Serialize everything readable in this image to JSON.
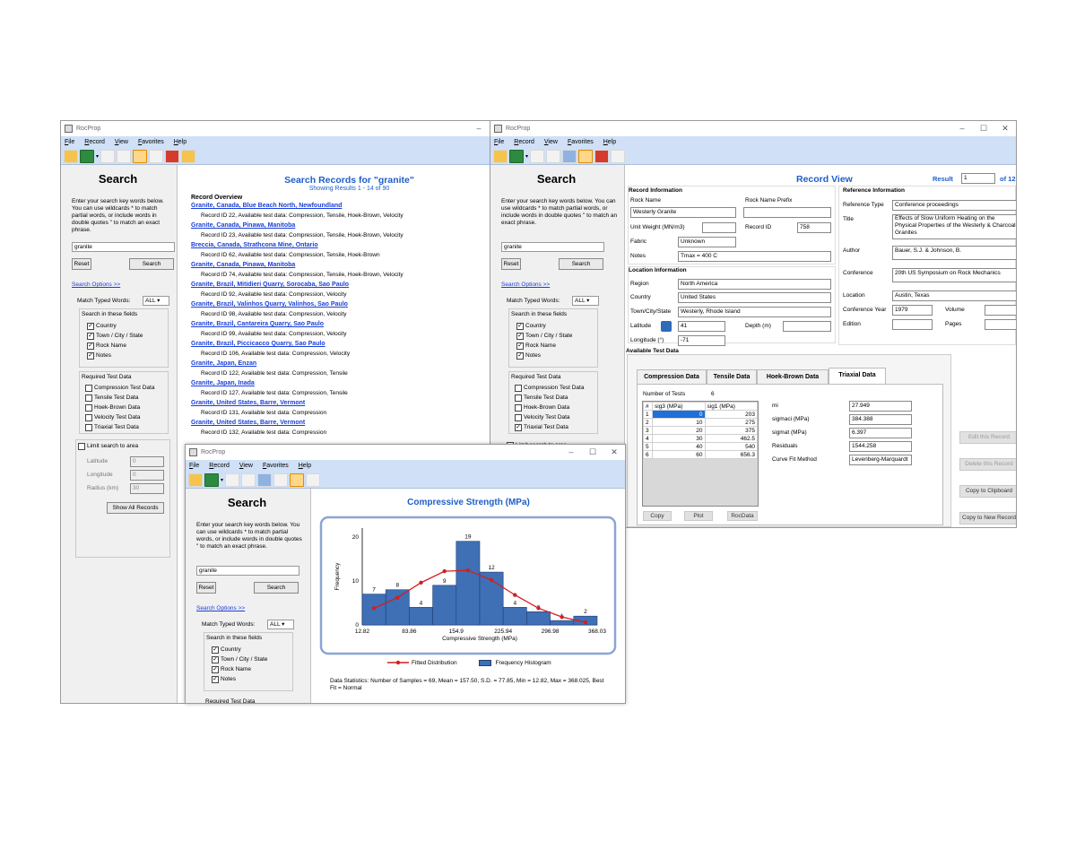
{
  "app_name": "RocProp",
  "menu": [
    "File",
    "Record",
    "View",
    "Favorites",
    "Help"
  ],
  "search_pane": {
    "title": "Search",
    "description": "Enter your search key words below. You can use wildcards * to match partial words, or include words in double quotes \" to match an exact phrase.",
    "query": "granite",
    "reset_label": "Reset",
    "search_label": "Search",
    "options_link": "Search Options  >>",
    "match_label": "Match Typed Words:",
    "match_value": "ALL",
    "fields_label": "Search in these fields",
    "fields": [
      "Country",
      "Town / City / State",
      "Rock Name",
      "Notes"
    ],
    "required_label": "Required Test Data",
    "required": [
      "Compression Test Data",
      "Tensile Test Data",
      "Hoek-Brown Data",
      "Velocity Test Data",
      "Triaxial Test Data"
    ],
    "limit_label": "Limit search to area",
    "latitude_label": "Latitude",
    "longitude_label": "Longitude",
    "radius_label": "Radius (km)",
    "latitude_value": "0",
    "longitude_value": "0",
    "radius_value": "30",
    "show_all_label": "Show All Records"
  },
  "results": {
    "title": "Search Records for \"granite\"",
    "subtitle": "Showing Results 1 - 14  of  90",
    "overview_label": "Record Overview",
    "records": [
      {
        "name": "Granite,  Canada,  Blue Beach North, Newfoundland",
        "info": "Record ID 22,  Available test data: Compression, Tensile, Hoek-Brown, Velocity"
      },
      {
        "name": "Granite,  Canada,  Pinawa, Manitoba",
        "info": "Record ID 23,  Available test data: Compression, Tensile, Hoek-Brown, Velocity"
      },
      {
        "name": "Breccia,  Canada,  Strathcona Mine, Ontario",
        "info": "Record ID 62,  Available test data: Compression, Tensile, Hoek-Brown"
      },
      {
        "name": "Granite,  Canada,  Pinawa, Manitoba",
        "info": "Record ID 74,  Available test data: Compression, Tensile, Hoek-Brown, Velocity"
      },
      {
        "name": "Granite,  Brazil,  Mitidieri Quarry, Sorocaba, Sao Paulo",
        "info": "Record ID 92,  Available test data: Compression, Velocity"
      },
      {
        "name": "Granite,  Brazil,  Valinhos Quarry, Valinhos, Sao Paulo",
        "info": "Record ID 98,  Available test data: Compression, Velocity"
      },
      {
        "name": "Granite,  Brazil,  Cantareira Quarry, Sao Paulo",
        "info": "Record ID 99,  Available test data: Compression, Velocity"
      },
      {
        "name": "Granite,  Brazil,  Piccicacco Quarry, Sao Paulo",
        "info": "Record ID 106,  Available test data: Compression, Velocity"
      },
      {
        "name": "Granite,  Japan,  Enzan",
        "info": "Record ID 122,  Available test data: Compression, Tensile"
      },
      {
        "name": "Granite,  Japan,  Inada",
        "info": "Record ID 127,  Available test data: Compression, Tensile"
      },
      {
        "name": "Granite,  United States,  Barre, Vermont",
        "info": "Record ID 131,  Available test data: Compression"
      },
      {
        "name": "Granite,  United States,  Barre, Vermont",
        "info": "Record ID 132,  Available test data: Compression"
      }
    ]
  },
  "record_view": {
    "title": "Record View",
    "result_label": "Result",
    "result_value": "1",
    "result_of": "of 12",
    "record_info_label": "Record Information",
    "rock_name_label": "Rock Name",
    "rock_name": "Westerly Granite",
    "prefix_label": "Rock Name Prefix",
    "unit_weight_label": "Unit Weight (MN/m3)",
    "record_id_label": "Record ID",
    "record_id": "758",
    "fabric_label": "Fabric",
    "fabric": "Unknown",
    "notes_label": "Notes",
    "notes": "Tmax = 400 C",
    "location_label": "Location Information",
    "region_label": "Region",
    "region": "North America",
    "country_label": "Country",
    "country": "United States",
    "town_label": "Town/City/State",
    "town": "Westerly, Rhode Island",
    "latitude_label": "Latitude",
    "latitude": "41",
    "depth_label": "Depth (m)",
    "longitude_label": "Longitude (°)",
    "longitude": "-71",
    "ref_info_label": "Reference Information",
    "ref_type_label": "Reference Type",
    "ref_type": "Conference proceedings",
    "ref_title_label": "Title",
    "ref_title": "Effects of Slow Uniform Heating on the Physical Properties of the Westerly & Charcoal Granites",
    "author_label": "Author",
    "author": "Bauer, S.J. & Johnson, B.",
    "conference_label": "Conference",
    "conference": "20th US Symposium on Rock Mechanics",
    "location_ref_label": "Location",
    "location_ref": "Austin, Texas",
    "conf_year_label": "Conference Year",
    "conf_year": "1979",
    "volume_label": "Volume",
    "edition_label": "Edition",
    "pages_label": "Pages",
    "available_label": "Available Test Data",
    "tabs": [
      "Compression Data",
      "Tensile Data",
      "Hoek-Brown Data",
      "Triaxial Data"
    ],
    "num_tests_label": "Number of Tests",
    "num_tests": "6",
    "table_headers": [
      "#",
      "sig3 (MPa)",
      "sig1 (MPa)"
    ],
    "table_rows": [
      [
        "1",
        "0",
        "203"
      ],
      [
        "2",
        "10",
        "275"
      ],
      [
        "3",
        "20",
        "375"
      ],
      [
        "4",
        "30",
        "462.5"
      ],
      [
        "5",
        "40",
        "540"
      ],
      [
        "6",
        "60",
        "656.3"
      ]
    ],
    "params": [
      {
        "label": "mi",
        "value": "27.949"
      },
      {
        "label": "sigmaci (MPa)",
        "value": "384.388"
      },
      {
        "label": "sigmat  (MPa)",
        "value": "6.397"
      },
      {
        "label": "Residuals",
        "value": "1544.258"
      },
      {
        "label": "Curve Fit Method",
        "value": "Levenberg-Marquardt"
      }
    ],
    "copy_label": "Copy",
    "plot_label": "Plot",
    "rocdata_label": "RocData",
    "edit_label": "Edit this Record",
    "delete_label": "Delete this Record",
    "clipboard_label": "Copy to Clipboard",
    "new_record_label": "Copy to New Record"
  },
  "chart_window": {
    "chart_title": "Compressive Strength (MPa)",
    "stats": "Data Statistics:   Number of Samples = 69,   Mean = 157.50,   S.D. = 77.85,   Min = 12.82,   Max = 368.025,   Best Fit = Normal"
  },
  "chart_data": {
    "type": "bar",
    "title": "Compressive Strength (MPa)",
    "xlabel": "Compressive Strength (MPa)",
    "ylabel": "Frequency",
    "x_ticks": [
      "12.82",
      "83.86",
      "154.9",
      "225.94",
      "296.98",
      "368.03"
    ],
    "y_ticks": [
      "0",
      "10",
      "20"
    ],
    "ylim": [
      0,
      22
    ],
    "xlim": [
      12.82,
      368.03
    ],
    "bin_edges": [
      12.82,
      48.34,
      83.86,
      119.38,
      154.9,
      190.42,
      225.94,
      261.46,
      296.98,
      332.5,
      368.03
    ],
    "values": [
      7,
      8,
      4,
      9,
      19,
      12,
      4,
      3,
      1,
      2
    ],
    "fitted_x": [
      30.58,
      66.1,
      101.62,
      137.14,
      172.66,
      208.18,
      243.7,
      279.22,
      314.74,
      350.26
    ],
    "fitted_y": [
      3.8,
      6.2,
      9.6,
      12.2,
      12.4,
      10.2,
      6.8,
      3.8,
      1.8,
      0.6
    ],
    "legend": [
      "Fitted Distribution",
      "Frequency Histogram"
    ],
    "colors": {
      "bar": "#3f6fb5",
      "line": "#d21f1f"
    }
  }
}
